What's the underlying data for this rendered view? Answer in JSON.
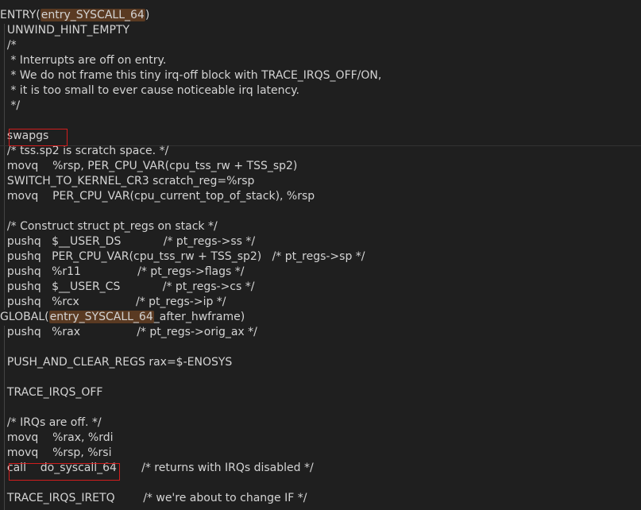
{
  "editor": {
    "lines": [
      {
        "text": ""
      },
      {
        "text": "  UNWIND_HINT_EMPTY"
      },
      {
        "text": "  /*"
      },
      {
        "text": "   * Interrupts are off on entry."
      },
      {
        "text": "   * We do not frame this tiny irq-off block with TRACE_IRQS_OFF/ON,"
      },
      {
        "text": "   * it is too small to ever cause noticeable irq latency."
      },
      {
        "text": "   */"
      },
      {
        "text": ""
      },
      {
        "text": "  swapgs"
      },
      {
        "text": "  /* tss.sp2 is scratch space. */"
      },
      {
        "text": "  movq    %rsp, PER_CPU_VAR(cpu_tss_rw + TSS_sp2)"
      },
      {
        "text": "  SWITCH_TO_KERNEL_CR3 scratch_reg=%rsp"
      },
      {
        "text": "  movq    PER_CPU_VAR(cpu_current_top_of_stack), %rsp"
      },
      {
        "text": ""
      },
      {
        "text": "  /* Construct struct pt_regs on stack */"
      },
      {
        "text": "  pushq   $__USER_DS            /* pt_regs->ss */"
      },
      {
        "text": "  pushq   PER_CPU_VAR(cpu_tss_rw + TSS_sp2)   /* pt_regs->sp */"
      },
      {
        "text": "  pushq   %r11                /* pt_regs->flags */"
      },
      {
        "text": "  pushq   $__USER_CS            /* pt_regs->cs */"
      },
      {
        "text": "  pushq   %rcx                /* pt_regs->ip */"
      },
      {
        "text": ""
      },
      {
        "text": "  pushq   %rax                /* pt_regs->orig_ax */"
      },
      {
        "text": ""
      },
      {
        "text": "  PUSH_AND_CLEAR_REGS rax=$-ENOSYS"
      },
      {
        "text": ""
      },
      {
        "text": "  TRACE_IRQS_OFF"
      },
      {
        "text": ""
      },
      {
        "text": "  /* IRQs are off. */"
      },
      {
        "text": "  movq    %rax, %rdi"
      },
      {
        "text": "  movq    %rsp, %rsi"
      },
      {
        "text": "  call    do_syscall_64       /* returns with IRQs disabled */"
      },
      {
        "text": ""
      },
      {
        "text": "  TRACE_IRQS_IRETQ        /* we're about to change IF */"
      }
    ],
    "entry_line": {
      "prefix": "ENTRY(",
      "highlight": "entry_SYSCALL_64",
      "suffix": ")"
    },
    "global_line": {
      "prefix": "GLOBAL(",
      "highlight": "entry_SYSCALL_64",
      "suffix": "_after_hwframe)"
    }
  },
  "colors": {
    "background": "#1f1f1f",
    "text": "#d4d4d4",
    "highlight": "#5a3a22",
    "annotation_box": "#d11e1e"
  }
}
